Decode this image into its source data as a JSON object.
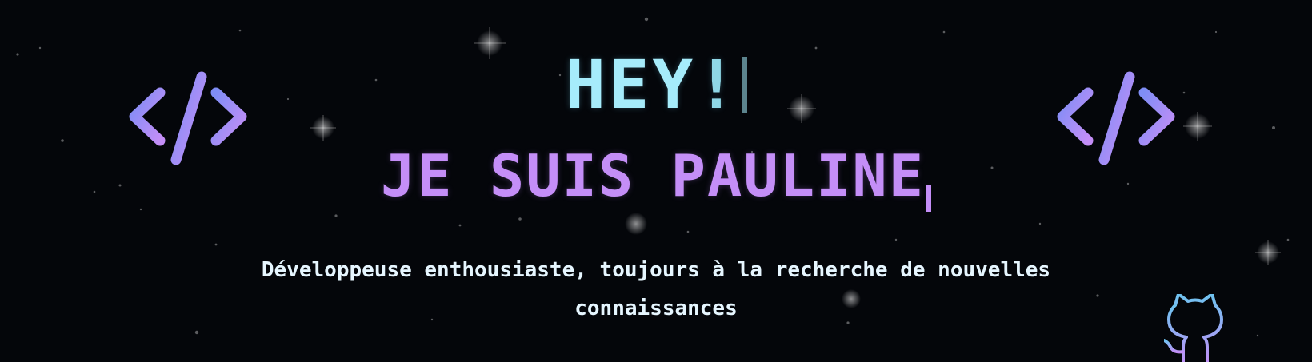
{
  "hero": {
    "greeting": "HEY",
    "greeting_mark": "!",
    "name_line": "JE SUIS PAULINE",
    "tagline_line1": "Développeuse enthousiaste, toujours à la recherche de nouvelles",
    "tagline_line2": "connaissances"
  },
  "icons": {
    "left": "code-brackets-icon",
    "right": "code-brackets-icon",
    "corner": "github-octocat-icon"
  },
  "colors": {
    "background": "#04060a",
    "greeting": "#a6ecfb",
    "name": "#c48ef7",
    "tagline": "#e6f6ff",
    "icon_gradient_start": "#7f8df5",
    "icon_gradient_end": "#c48ef7"
  }
}
